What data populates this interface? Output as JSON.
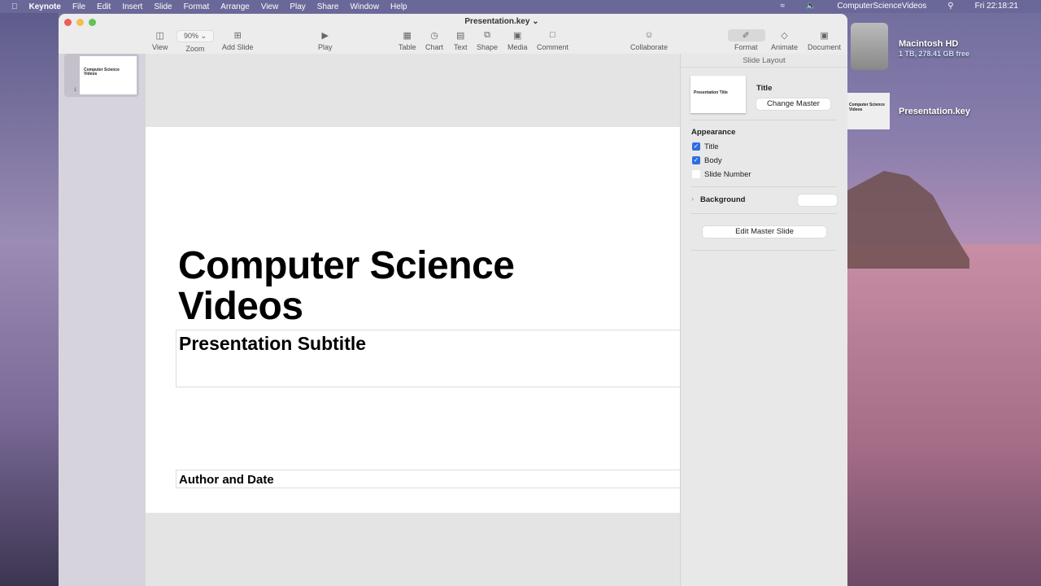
{
  "menubar": {
    "app": "Keynote",
    "items": [
      "File",
      "Edit",
      "Insert",
      "Slide",
      "Format",
      "Arrange",
      "View",
      "Play",
      "Share",
      "Window",
      "Help"
    ],
    "user": "ComputerScienceVideos",
    "clock": "Fri  22:18:21"
  },
  "window": {
    "title": "Presentation.key"
  },
  "toolbar": {
    "view": "View",
    "zoom_value": "90%",
    "zoom": "Zoom",
    "add_slide": "Add Slide",
    "play": "Play",
    "table": "Table",
    "chart": "Chart",
    "text": "Text",
    "shape": "Shape",
    "media": "Media",
    "comment": "Comment",
    "collaborate": "Collaborate",
    "format": "Format",
    "animate": "Animate",
    "document": "Document"
  },
  "navigator": {
    "slides": [
      {
        "number": "1",
        "title": "Computer Science Videos"
      }
    ]
  },
  "slide": {
    "title_line1": "Computer Science",
    "title_line2": "Videos",
    "subtitle": "Presentation Subtitle",
    "author": "Author and Date"
  },
  "inspector": {
    "header": "Slide Layout",
    "master_thumb_title": "Presentation Title",
    "master_name": "Title",
    "change_master": "Change Master",
    "appearance": "Appearance",
    "options": [
      {
        "label": "Title",
        "checked": true
      },
      {
        "label": "Body",
        "checked": true
      },
      {
        "label": "Slide Number",
        "checked": false
      }
    ],
    "background": "Background",
    "edit_master": "Edit Master Slide"
  },
  "desktop": {
    "disk_name": "Macintosh HD",
    "disk_info": "1 TB, 278.41 GB free",
    "file_name": "Presentation.key",
    "file_thumb": "Computer Science Videos"
  }
}
